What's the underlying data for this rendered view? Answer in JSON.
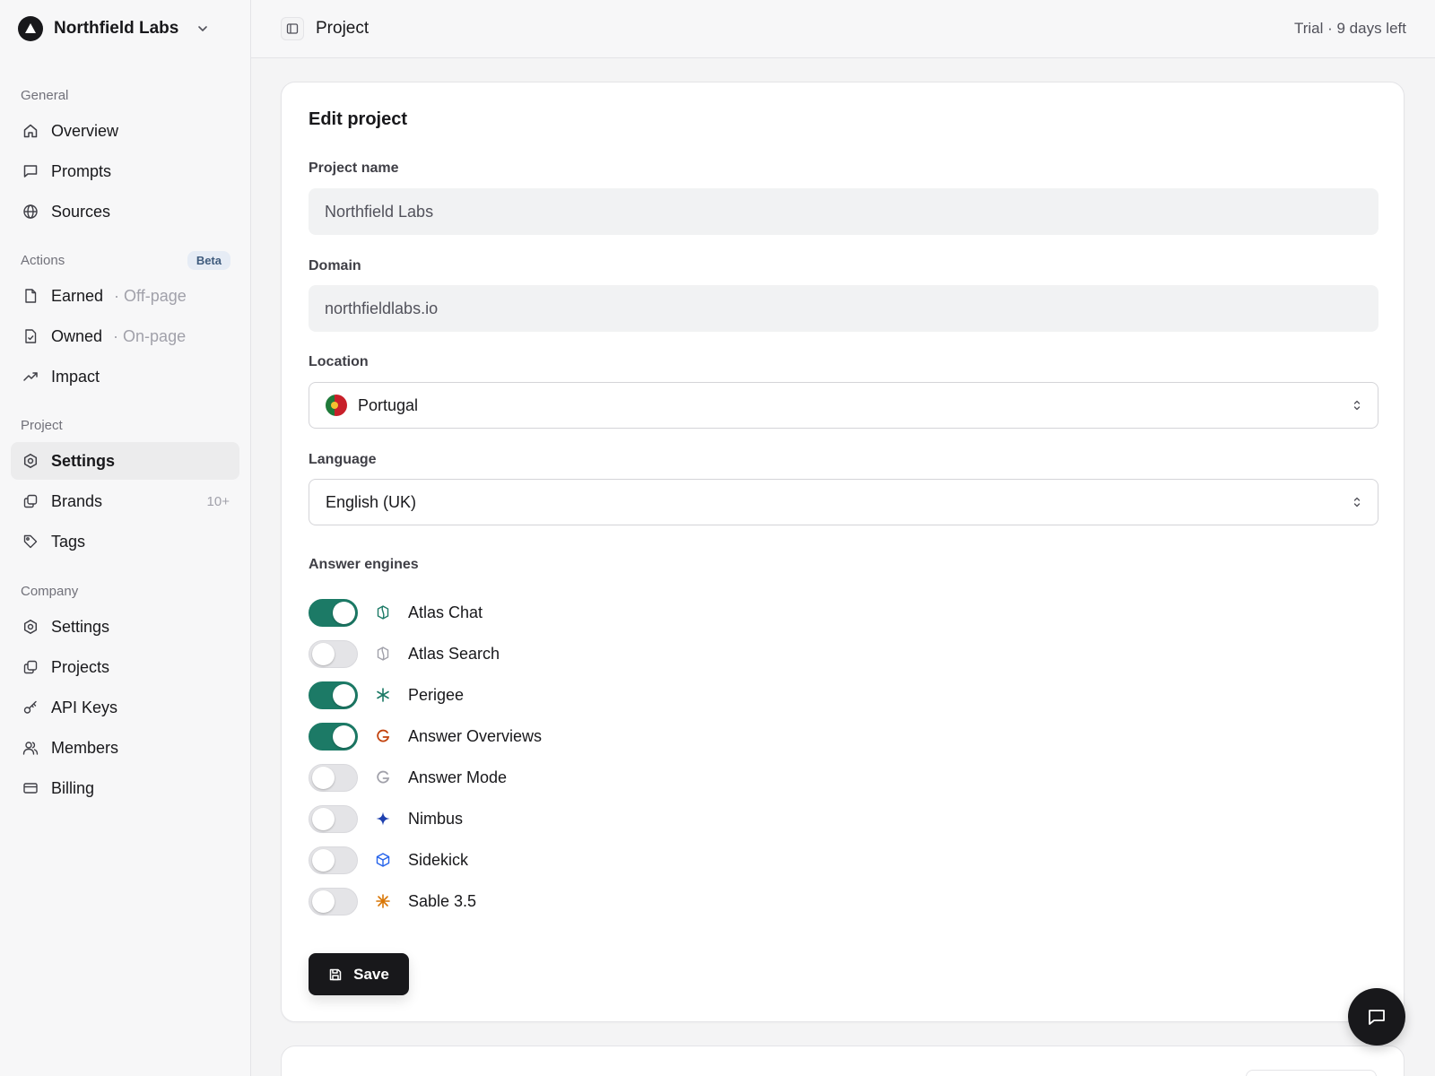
{
  "org": {
    "name": "Northfield Labs"
  },
  "sidebar": {
    "general": {
      "title": "General",
      "items": [
        {
          "label": "Overview",
          "icon": "home-icon"
        },
        {
          "label": "Prompts",
          "icon": "message-square-icon"
        },
        {
          "label": "Sources",
          "icon": "globe-icon"
        }
      ]
    },
    "actions": {
      "title": "Actions",
      "badge": "Beta",
      "items": [
        {
          "label": "Earned",
          "sub": "· Off-page",
          "icon": "file-icon"
        },
        {
          "label": "Owned",
          "sub": "· On-page",
          "icon": "file-check-icon"
        },
        {
          "label": "Impact",
          "icon": "trending-up-icon"
        }
      ]
    },
    "project": {
      "title": "Project",
      "items": [
        {
          "label": "Settings",
          "icon": "settings-icon",
          "active": true
        },
        {
          "label": "Brands",
          "count": "10+",
          "icon": "copy-icon"
        },
        {
          "label": "Tags",
          "icon": "tag-icon"
        }
      ]
    },
    "company": {
      "title": "Company",
      "items": [
        {
          "label": "Settings",
          "icon": "settings-icon"
        },
        {
          "label": "Projects",
          "icon": "copy-icon"
        },
        {
          "label": "API Keys",
          "icon": "key-icon"
        },
        {
          "label": "Members",
          "icon": "users-icon"
        },
        {
          "label": "Billing",
          "icon": "credit-card-icon"
        }
      ]
    }
  },
  "topbar": {
    "title": "Project",
    "trial": "Trial · 9 days left"
  },
  "form": {
    "title": "Edit project",
    "project_name": {
      "label": "Project name",
      "value": "Northfield Labs"
    },
    "domain": {
      "label": "Domain",
      "value": "northfieldlabs.io"
    },
    "location": {
      "label": "Location",
      "value": "Portugal"
    },
    "language": {
      "label": "Language",
      "value": "English (UK)"
    },
    "engines": {
      "label": "Answer engines",
      "items": [
        {
          "name": "Atlas Chat",
          "enabled": true,
          "icon": "atlas-icon",
          "color": "#1c7a66"
        },
        {
          "name": "Atlas Search",
          "enabled": false,
          "icon": "atlas-icon",
          "color": "#a1a1aa"
        },
        {
          "name": "Perigee",
          "enabled": true,
          "icon": "asterisk-icon",
          "color": "#1c7a66"
        },
        {
          "name": "Answer Overviews",
          "enabled": true,
          "icon": "g-letter-icon",
          "color": "#c2410c"
        },
        {
          "name": "Answer Mode",
          "enabled": false,
          "icon": "g-letter-icon",
          "color": "#a1a1aa"
        },
        {
          "name": "Nimbus",
          "enabled": false,
          "icon": "sparkle-icon",
          "color": "#1e40af"
        },
        {
          "name": "Sidekick",
          "enabled": false,
          "icon": "cube-icon",
          "color": "#2563eb"
        },
        {
          "name": "Sable 3.5",
          "enabled": false,
          "icon": "starburst-icon",
          "color": "#d97706"
        }
      ]
    },
    "save_label": "Save"
  },
  "colors": {
    "accent": "#1c7a66",
    "dark": "#18181b"
  }
}
